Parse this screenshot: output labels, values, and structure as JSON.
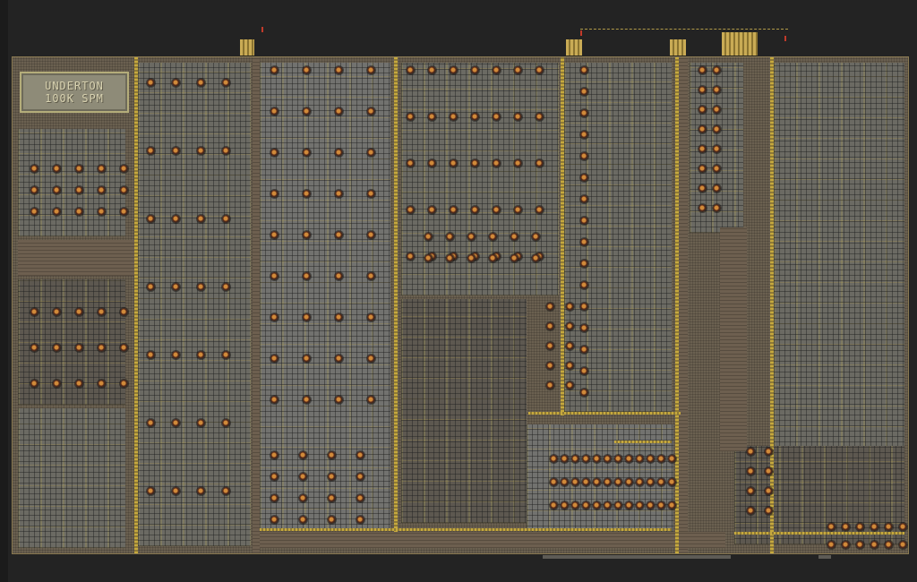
{
  "view": {
    "background": "#232323",
    "floor_color": "#6a6050",
    "belt_color": "#c6a93e",
    "furnace_glow": "#d08a3a",
    "pole_color": "#c23a2a"
  },
  "label_plate": {
    "line1": "UNDERTON",
    "line2": "100K SPM"
  },
  "icons": {
    "furnace": "furnace-icon",
    "belt": "belt-icon",
    "power-pole": "power-pole-icon",
    "train-stop": "train-stop-icon"
  }
}
